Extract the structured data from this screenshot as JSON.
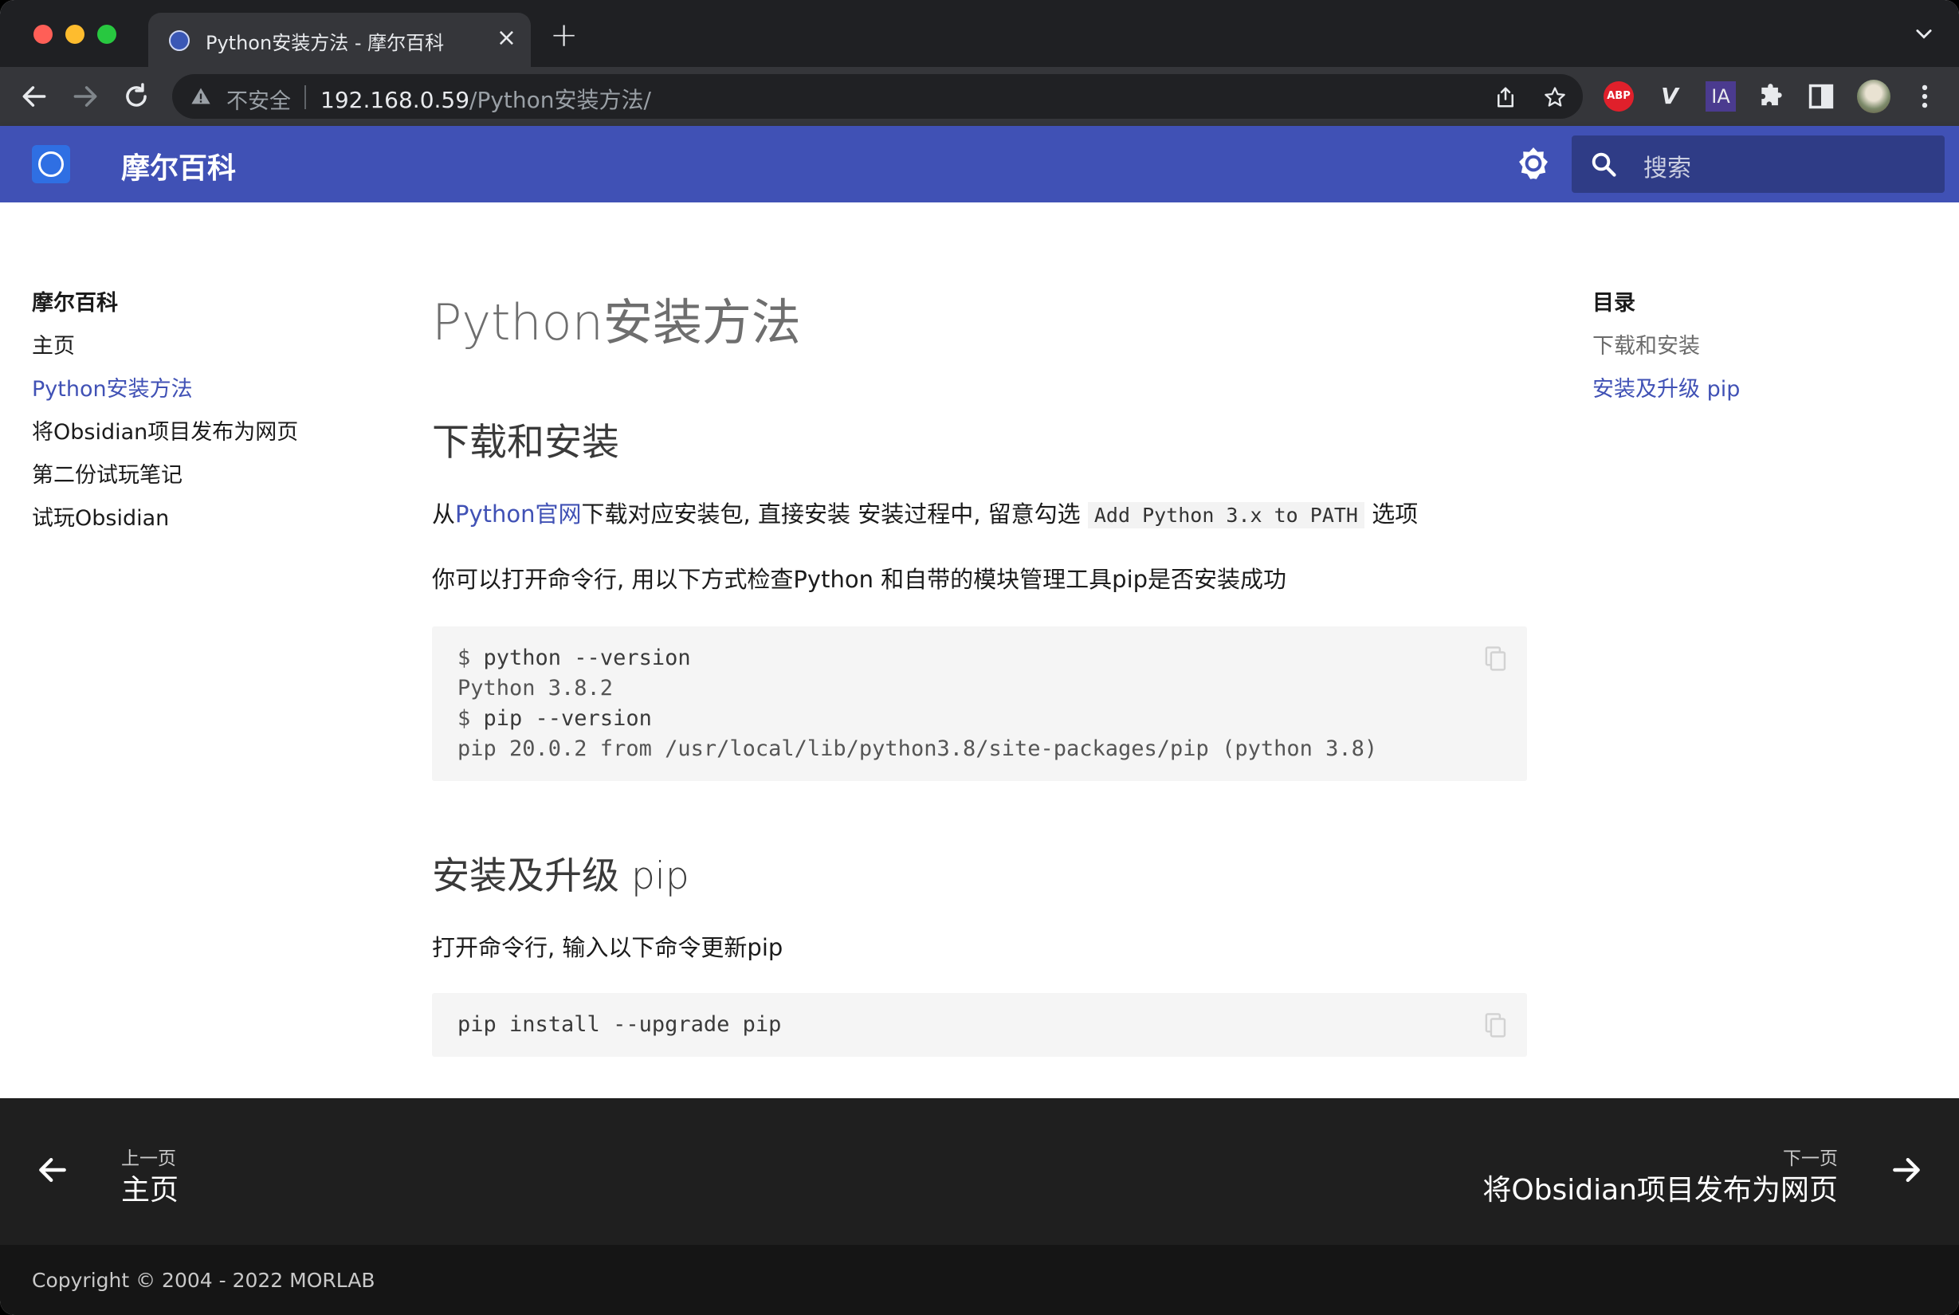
{
  "browser": {
    "tab_title": "Python安装方法 - 摩尔百科",
    "tab_close": "×",
    "new_tab": "+",
    "security_label": "不安全",
    "url_host": "192.168.0.59",
    "url_path": "/Python安装方法/",
    "extensions": {
      "abp": "ABP",
      "vd": "V",
      "ia": "IA"
    }
  },
  "header": {
    "site_title": "摩尔百科",
    "search_placeholder": "搜索",
    "brand_color": "#4051b5"
  },
  "sidebar": {
    "title": "摩尔百科",
    "items": [
      {
        "label": "主页",
        "active": false
      },
      {
        "label": "Python安装方法",
        "active": true
      },
      {
        "label": "将Obsidian项目发布为网页",
        "active": false
      },
      {
        "label": "第二份试玩笔记",
        "active": false
      },
      {
        "label": "试玩Obsidian",
        "active": false
      }
    ]
  },
  "toc": {
    "title": "目录",
    "items": [
      {
        "label": "下载和安装"
      },
      {
        "label": "安装及升级 pip"
      }
    ]
  },
  "article": {
    "title": "Python安装方法",
    "section1": {
      "heading": "下载和安装",
      "p1_prefix": "从",
      "p1_link": "Python官网",
      "p1_middle": "下载对应安装包, 直接安装  安装过程中, 留意勾选",
      "p1_code": "Add Python 3.x to PATH",
      "p1_suffix": "选项",
      "p2": "你可以打开命令行, 用以下方式检查Python 和自带的模块管理工具pip是否安装成功",
      "code": [
        {
          "prompt": "$ ",
          "text": "python --version",
          "kind": "cmd"
        },
        {
          "prompt": "",
          "text": "Python 3.8.2",
          "kind": "out"
        },
        {
          "prompt": "$ ",
          "text": "pip --version",
          "kind": "cmd"
        },
        {
          "prompt": "",
          "text": "pip 20.0.2 from /usr/local/lib/python3.8/site-packages/pip (python 3.8)",
          "kind": "out"
        }
      ]
    },
    "section2": {
      "heading": "安装及升级 pip",
      "p1": "打开命令行, 输入以下命令更新pip",
      "code": [
        {
          "prompt": "",
          "text": "pip install --upgrade pip",
          "kind": "out"
        }
      ]
    }
  },
  "footer": {
    "prev_label": "上一页",
    "prev_title": "主页",
    "next_label": "下一页",
    "next_title": "将Obsidian项目发布为网页",
    "copyright": "Copyright © 2004 - 2022 MORLAB"
  }
}
